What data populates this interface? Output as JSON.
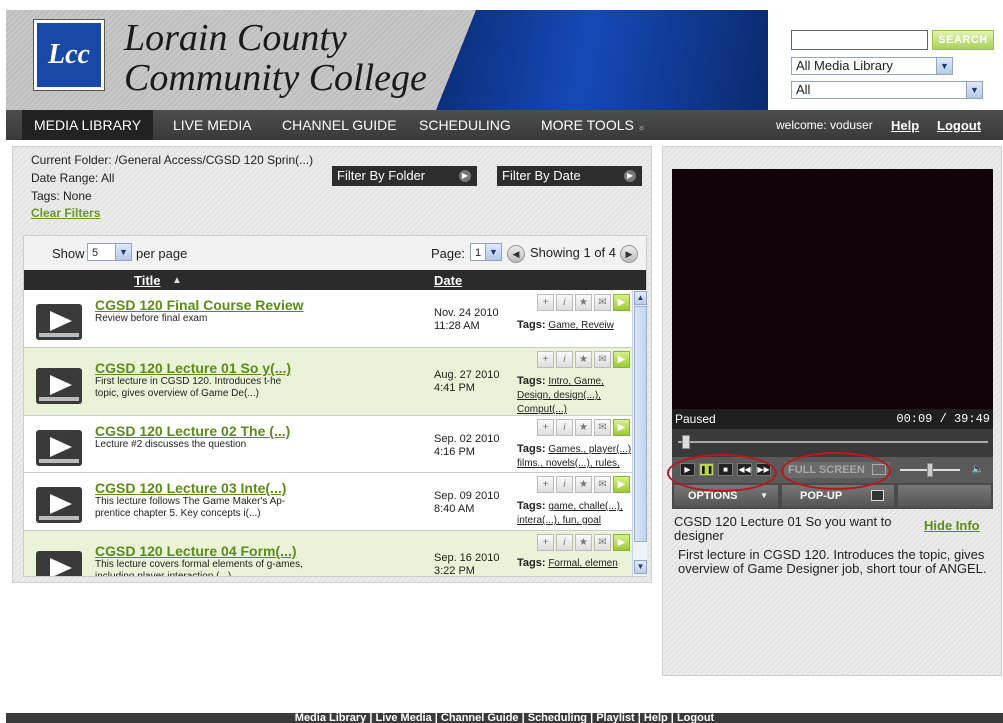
{
  "header": {
    "logo_text": "Lcc",
    "college_name_line1": "Lorain County",
    "college_name_line2": "Community College",
    "search_button": "SEARCH",
    "search_value": "",
    "select_library": "All Media Library",
    "select_all": "All"
  },
  "nav": {
    "items": [
      "MEDIA LIBRARY",
      "LIVE MEDIA",
      "CHANNEL GUIDE",
      "SCHEDULING",
      "MORE TOOLS"
    ],
    "more_arrow": "»",
    "welcome": "welcome: voduser",
    "help": "Help",
    "logout": "Logout"
  },
  "filters": {
    "current_folder": "Current Folder: /General Access/CGSD 120 Sprin(...)",
    "date_range": "Date Range: All",
    "tags": "Tags: None",
    "clear": "Clear Filters",
    "by_folder": "Filter By Folder",
    "by_date": "Filter By Date"
  },
  "pager": {
    "show": "Show",
    "per_page_value": "5",
    "per_page": "per page",
    "page": "Page:",
    "page_value": "1",
    "showing": "Showing 1 of 4"
  },
  "table": {
    "col_title": "Title",
    "col_date": "Date",
    "tags_label": "Tags:",
    "rows": [
      {
        "title": "CGSD 120 Final Course Review",
        "desc": "Review before final exam",
        "date": "Nov. 24 2010",
        "time": "11:28 AM",
        "tags": "Game, Reveiw"
      },
      {
        "title": "CGSD 120 Lecture 01 So y(...)",
        "desc": "First lecture in CGSD 120. Introduces t-he topic, gives overview of Game De(...)",
        "date": "Aug. 27 2010",
        "time": "4:41 PM",
        "tags": "Intro, Game, Design, design(...), Comput(...)"
      },
      {
        "title": "CGSD 120 Lecture 02 The (...)",
        "desc": "Lecture #2 discusses the question",
        "date": "Sep. 02 2010",
        "time": "4:16 PM",
        "tags": "Games., player(...) films., novels(...), rules,"
      },
      {
        "title": "CGSD 120 Lecture 03 Inte(...)",
        "desc": "This lecture follows The Game Maker's Ap-prentice chapter 5. Key concepts i(...)",
        "date": "Sep. 09 2010",
        "time": "8:40 AM",
        "tags": "game, challe(...), intera(...), fun, goal"
      },
      {
        "title": "CGSD 120 Lecture 04 Form(...)",
        "desc": "This lecture covers formal elements of g-ames, including player interaction (...)",
        "date": "Sep. 16 2010",
        "time": "3:22 PM",
        "tags": "Formal, elemen"
      }
    ]
  },
  "player": {
    "status": "Paused",
    "time": "00:09 / 39:49",
    "progress": 0.004,
    "volume": 0.5,
    "fullscreen": "FULL SCREEN",
    "options": "OPTIONS",
    "popup": "POP-UP",
    "video_title": "CGSD 120 Lecture 01 So you want to designer",
    "hide_info": "Hide Info",
    "description": "First lecture in CGSD 120. Introduces the topic, gives overview of Game Designer job, short tour of ANGEL."
  },
  "footer": {
    "links": "Media Library | Live Media | Channel Guide | Scheduling | Playlist | Help | Logout"
  },
  "colors": {
    "accent_green": "#5b8c1a",
    "header_blue": "#1549b8",
    "nav_dark": "#3a3a3a"
  }
}
